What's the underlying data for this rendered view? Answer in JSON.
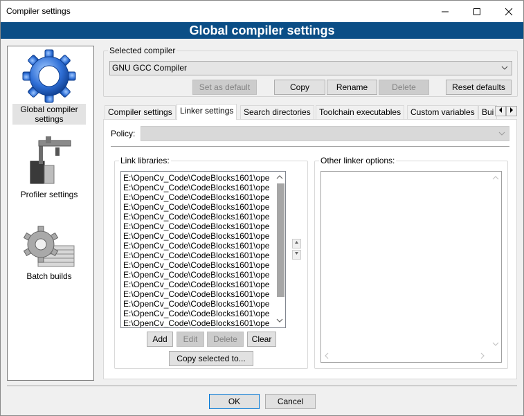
{
  "window": {
    "title": "Compiler settings",
    "minimize": "—",
    "maximize": "☐",
    "close": "✕"
  },
  "banner": {
    "title": "Global compiler settings"
  },
  "sidebar": {
    "items": [
      {
        "label_line1": "Global compiler",
        "label_line2": "settings",
        "icon": "gear-icon"
      },
      {
        "label": "Profiler settings",
        "icon": "profiler-icon"
      },
      {
        "label": "Batch builds",
        "icon": "batch-gear-icon"
      }
    ]
  },
  "compiler": {
    "group_label": "Selected compiler",
    "selected": "GNU GCC Compiler",
    "buttons": {
      "set_default": "Set as default",
      "copy": "Copy",
      "rename": "Rename",
      "delete": "Delete",
      "reset": "Reset defaults"
    }
  },
  "tabs": [
    "Compiler settings",
    "Linker settings",
    "Search directories",
    "Toolchain executables",
    "Custom variables",
    "Bui"
  ],
  "tab_scroll": {
    "left": "◀",
    "right": "▶"
  },
  "linker": {
    "policy_label": "Policy:",
    "policy_value": "",
    "link_libraries_label": "Link libraries:",
    "libraries": [
      "E:\\OpenCv_Code\\CodeBlocks1601\\ope",
      "E:\\OpenCv_Code\\CodeBlocks1601\\ope",
      "E:\\OpenCv_Code\\CodeBlocks1601\\ope",
      "E:\\OpenCv_Code\\CodeBlocks1601\\ope",
      "E:\\OpenCv_Code\\CodeBlocks1601\\ope",
      "E:\\OpenCv_Code\\CodeBlocks1601\\ope",
      "E:\\OpenCv_Code\\CodeBlocks1601\\ope",
      "E:\\OpenCv_Code\\CodeBlocks1601\\ope",
      "E:\\OpenCv_Code\\CodeBlocks1601\\ope",
      "E:\\OpenCv_Code\\CodeBlocks1601\\ope",
      "E:\\OpenCv_Code\\CodeBlocks1601\\ope",
      "E:\\OpenCv_Code\\CodeBlocks1601\\ope",
      "E:\\OpenCv_Code\\CodeBlocks1601\\ope",
      "E:\\OpenCv_Code\\CodeBlocks1601\\ope",
      "E:\\OpenCv_Code\\CodeBlocks1601\\ope",
      "E:\\OpenCv_Code\\CodeBlocks1601\\ope"
    ],
    "buttons": {
      "add": "Add",
      "edit": "Edit",
      "delete": "Delete",
      "clear": "Clear",
      "copy_selected": "Copy selected to..."
    },
    "other_options_label": "Other linker options:",
    "other_options_value": ""
  },
  "dialog": {
    "ok": "OK",
    "cancel": "Cancel"
  },
  "colors": {
    "banner": "#0b4e86",
    "disabled_text": "#838383"
  }
}
